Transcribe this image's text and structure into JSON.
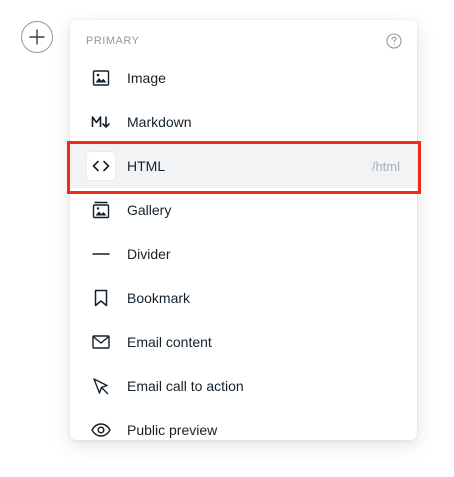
{
  "add_button": {
    "icon": "plus-icon"
  },
  "menu": {
    "section_title": "PRIMARY",
    "help_icon": "question-circle-icon",
    "items": [
      {
        "label": "Image",
        "icon": "image-icon",
        "shortcut": ""
      },
      {
        "label": "Markdown",
        "icon": "markdown-icon",
        "shortcut": ""
      },
      {
        "label": "HTML",
        "icon": "code-icon",
        "shortcut": "/html",
        "selected": true
      },
      {
        "label": "Gallery",
        "icon": "gallery-icon",
        "shortcut": ""
      },
      {
        "label": "Divider",
        "icon": "divider-icon",
        "shortcut": ""
      },
      {
        "label": "Bookmark",
        "icon": "bookmark-icon",
        "shortcut": ""
      },
      {
        "label": "Email content",
        "icon": "envelope-icon",
        "shortcut": ""
      },
      {
        "label": "Email call to action",
        "icon": "cursor-click-icon",
        "shortcut": ""
      },
      {
        "label": "Public preview",
        "icon": "eye-icon",
        "shortcut": ""
      }
    ]
  },
  "colors": {
    "highlight": "#ee2b1d",
    "selected_bg": "#f1f3f4",
    "text": "#15212a",
    "muted": "#8e9aa3"
  }
}
